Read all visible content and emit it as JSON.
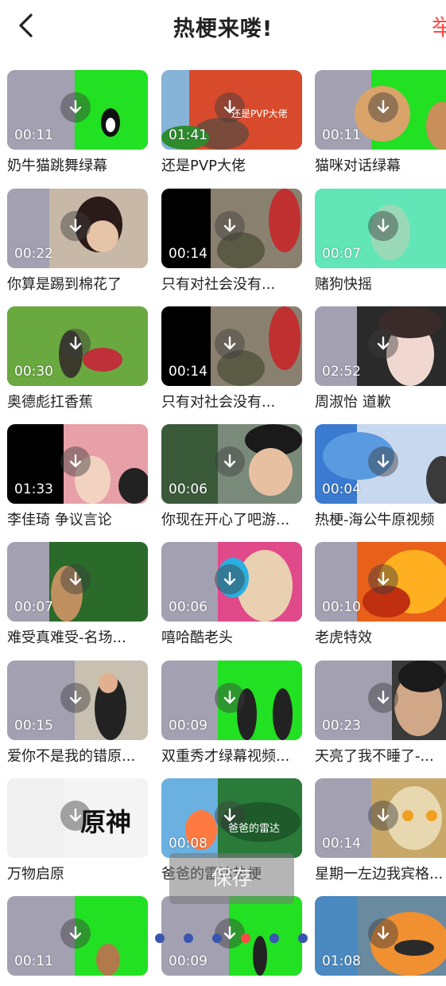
{
  "header": {
    "title": "热梗来喽!",
    "report_label": "举"
  },
  "videos": [
    {
      "name": "奶牛猫跳舞绿幕",
      "duration": "00:11",
      "icon": "download-icon"
    },
    {
      "name": "还是PVP大佬",
      "duration": "01:41",
      "overlay_text": "还是PVP大佬",
      "icon": "download-icon"
    },
    {
      "name": "猫咪对话绿幕",
      "duration": "00:11",
      "icon": "download-icon"
    },
    {
      "name": "你算是踢到棉花了",
      "duration": "00:22",
      "icon": "download-icon"
    },
    {
      "name": "只有对社会没有...",
      "duration": "00:14",
      "icon": "download-icon"
    },
    {
      "name": "赌狗快摇",
      "duration": "00:07",
      "icon": "download-icon"
    },
    {
      "name": "奥德彪扛香蕉",
      "duration": "00:30",
      "icon": "download-icon"
    },
    {
      "name": "只有对社会没有...",
      "duration": "00:14",
      "icon": "download-icon"
    },
    {
      "name": "周淑怡 道歉",
      "duration": "02:52",
      "icon": "download-icon"
    },
    {
      "name": "李佳琦 争议言论",
      "duration": "01:33",
      "icon": "download-icon"
    },
    {
      "name": "你现在开心了吧游...",
      "duration": "00:06",
      "icon": "download-icon"
    },
    {
      "name": "热梗-海公牛原视频",
      "duration": "00:04",
      "icon": "download-icon"
    },
    {
      "name": "难受真难受-名场...",
      "duration": "00:07",
      "icon": "download-icon"
    },
    {
      "name": "嘻哈酷老头",
      "duration": "00:06",
      "icon": "download-icon"
    },
    {
      "name": "老虎特效",
      "duration": "00:10",
      "icon": "download-icon"
    },
    {
      "name": "爱你不是我的错原...",
      "duration": "00:15",
      "icon": "download-icon"
    },
    {
      "name": "双重秀才绿幕视频...",
      "duration": "00:09",
      "icon": "download-icon"
    },
    {
      "name": "天亮了我不睡了-...",
      "duration": "00:23",
      "icon": "download-icon"
    },
    {
      "name": "万物启原",
      "duration": "",
      "overlay_text": "原神",
      "icon": "download-icon"
    },
    {
      "name": "爸爸的雷达热梗",
      "duration": "00:08",
      "overlay_text": "爸爸的雷达",
      "icon": "download-icon"
    },
    {
      "name": "星期一左边我宾格...",
      "duration": "00:14",
      "icon": "download-icon"
    },
    {
      "name": "",
      "duration": "00:11",
      "icon": "download-icon"
    },
    {
      "name": "",
      "duration": "00:09",
      "icon": "download-icon"
    },
    {
      "name": "",
      "duration": "01:08",
      "icon": "download-icon"
    }
  ],
  "toast": {
    "save_label": "保存"
  },
  "loading_dots": {
    "count": 6,
    "active_index": 3
  },
  "colors": {
    "accent": "#ff4a4a",
    "placeholder": "#a3a0b2",
    "green_screen": "#22e022",
    "dot": "#3a55b0"
  }
}
